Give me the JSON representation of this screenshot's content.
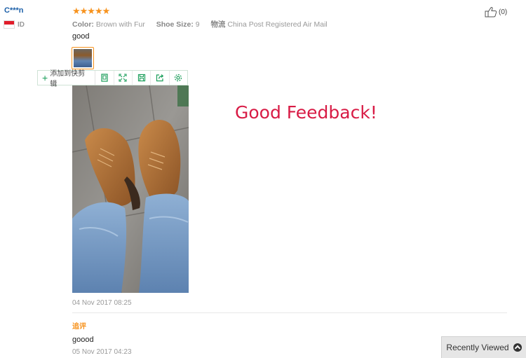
{
  "review": {
    "reviewer": "C***n",
    "country": "ID",
    "rating": 5,
    "stars": "★★★★★",
    "properties": [
      {
        "key": "Color:",
        "value": "Brown with Fur"
      },
      {
        "key": "Shoe Size:",
        "value": "9"
      },
      {
        "key": "物流",
        "value": "China Post Registered Air Mail"
      }
    ],
    "text": "good",
    "date": "04 Nov 2017 08:25",
    "helpful_count": "(0)",
    "followup": {
      "label": "追评",
      "text": "goood",
      "date": "05 Nov 2017 04:23"
    }
  },
  "clip_toolbar": {
    "add_label": "添加到快剪辑",
    "icons": [
      "screenshot-icon",
      "fullscreen-icon",
      "save-icon",
      "share-icon",
      "settings-icon"
    ]
  },
  "overlay": {
    "text": "Good Feedback!"
  },
  "recently_viewed": {
    "label": "Recently Viewed"
  },
  "colors": {
    "star": "#f7931e",
    "overlay_text": "#d81b45",
    "reviewer_name": "#1b5fa8",
    "toolbar_green": "#1a9e5a"
  }
}
